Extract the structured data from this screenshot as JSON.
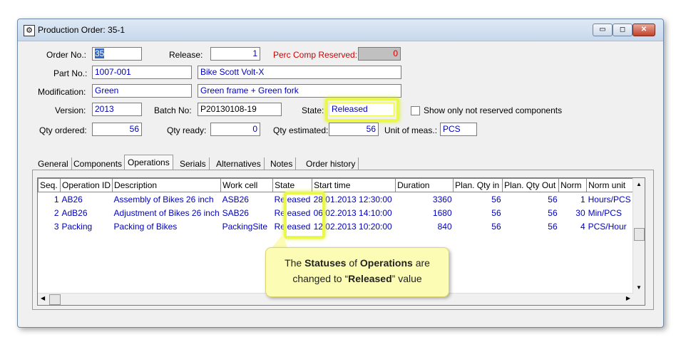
{
  "window": {
    "title": "Production Order: 35-1",
    "buttons": {
      "minimize": "▭",
      "maximize": "◻",
      "close": "✕"
    }
  },
  "form": {
    "order_no_label": "Order No.:",
    "order_no": "35",
    "release_label": "Release:",
    "release": "1",
    "perc_comp_label": "Perc Comp Reserved:",
    "perc_comp": "0",
    "part_no_label": "Part No.:",
    "part_no": "1007-001",
    "part_desc": "Bike Scott Volt-X",
    "modification_label": "Modification:",
    "modification": "Green",
    "modification_desc": "Green frame + Green fork",
    "version_label": "Version:",
    "version": "2013",
    "batch_no_label": "Batch No:",
    "batch_no": "P20130108-19",
    "state_label": "State:",
    "state": "Released",
    "show_only_label": "Show only not reserved components",
    "qty_ordered_label": "Qty ordered:",
    "qty_ordered": "56",
    "qty_ready_label": "Qty ready:",
    "qty_ready": "0",
    "qty_estimated_label": "Qty estimated:",
    "qty_estimated": "56",
    "unit_label": "Unit of meas.:",
    "unit": "PCS"
  },
  "tabs": [
    "General",
    "Components",
    "Operations",
    "Serials",
    "Alternatives",
    "Notes",
    "Order history"
  ],
  "table": {
    "headers": [
      "Seq.",
      "Operation ID",
      "Description",
      "Work cell",
      "State",
      "Start time",
      "Duration",
      "Plan. Qty in",
      "Plan. Qty Out",
      "Norm",
      "Norm unit"
    ],
    "rows": [
      [
        "1",
        "AB26",
        "Assembly of Bikes 26 inch",
        "ASB26",
        "Released",
        "28.01.2013 12:30:00",
        "3360",
        "56",
        "56",
        "1",
        "Hours/PCS"
      ],
      [
        "2",
        "AdB26",
        "Adjustment of Bikes 26 inch",
        "SAB26",
        "Released",
        "06.02.2013 14:10:00",
        "1680",
        "56",
        "56",
        "30",
        "Min/PCS"
      ],
      [
        "3",
        "Packing",
        "Packing of Bikes",
        "PackingSite",
        "Released",
        "12.02.2013 10:20:00",
        "840",
        "56",
        "56",
        "4",
        "PCS/Hour"
      ]
    ]
  },
  "callout": {
    "t1": "The ",
    "b1": "Statuses",
    "t2": " of ",
    "b2": "Operations",
    "t3": " are",
    "t4": "changed to “",
    "b3": "Released",
    "t5": "” value"
  },
  "colors": {
    "value_text": "#0000c0",
    "highlight": "#e9f84a",
    "callout_bg": "#fdfcb4"
  }
}
